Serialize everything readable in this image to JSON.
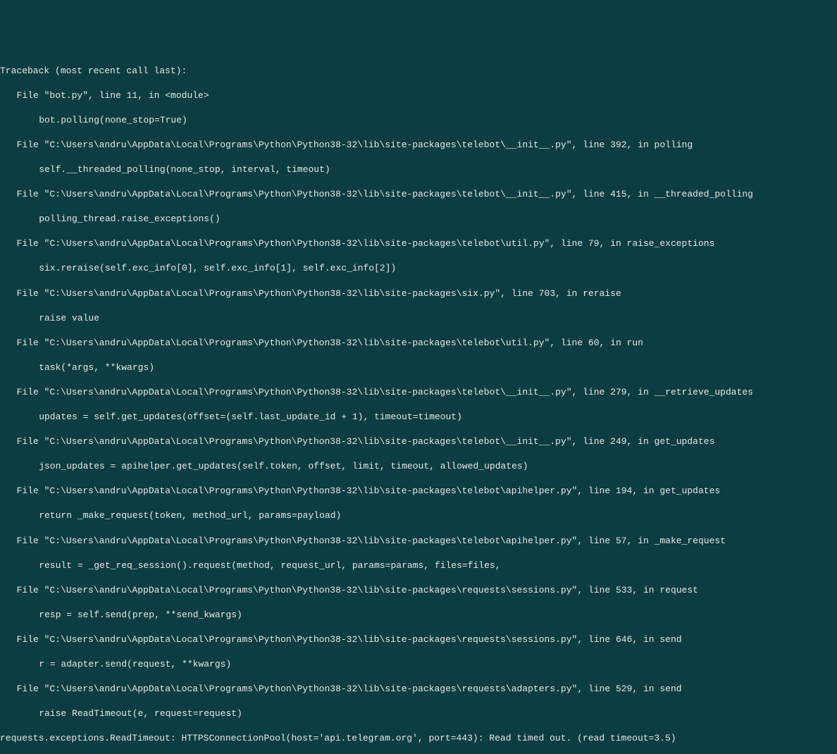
{
  "traceback": {
    "header": "Traceback (most recent call last):",
    "frames": [
      {
        "file": "  File \"bot.py\", line 11, in <module>",
        "code": "    bot.polling(none_stop=True)"
      },
      {
        "file": "  File \"C:\\Users\\andru\\AppData\\Local\\Programs\\Python\\Python38-32\\lib\\site-packages\\telebot\\__init__.py\", line 392, in polling",
        "code": "    self.__threaded_polling(none_stop, interval, timeout)"
      },
      {
        "file": "  File \"C:\\Users\\andru\\AppData\\Local\\Programs\\Python\\Python38-32\\lib\\site-packages\\telebot\\__init__.py\", line 415, in __threaded_polling",
        "code": "    polling_thread.raise_exceptions()"
      },
      {
        "file": "  File \"C:\\Users\\andru\\AppData\\Local\\Programs\\Python\\Python38-32\\lib\\site-packages\\telebot\\util.py\", line 79, in raise_exceptions",
        "code": "    six.reraise(self.exc_info[0], self.exc_info[1], self.exc_info[2])"
      },
      {
        "file": "  File \"C:\\Users\\andru\\AppData\\Local\\Programs\\Python\\Python38-32\\lib\\site-packages\\six.py\", line 703, in reraise",
        "code": "    raise value"
      },
      {
        "file": "  File \"C:\\Users\\andru\\AppData\\Local\\Programs\\Python\\Python38-32\\lib\\site-packages\\telebot\\util.py\", line 60, in run",
        "code": "    task(*args, **kwargs)"
      },
      {
        "file": "  File \"C:\\Users\\andru\\AppData\\Local\\Programs\\Python\\Python38-32\\lib\\site-packages\\telebot\\__init__.py\", line 279, in __retrieve_updates",
        "code": "    updates = self.get_updates(offset=(self.last_update_id + 1), timeout=timeout)"
      },
      {
        "file": "  File \"C:\\Users\\andru\\AppData\\Local\\Programs\\Python\\Python38-32\\lib\\site-packages\\telebot\\__init__.py\", line 249, in get_updates",
        "code": "    json_updates = apihelper.get_updates(self.token, offset, limit, timeout, allowed_updates)"
      },
      {
        "file": "  File \"C:\\Users\\andru\\AppData\\Local\\Programs\\Python\\Python38-32\\lib\\site-packages\\telebot\\apihelper.py\", line 194, in get_updates",
        "code": "    return _make_request(token, method_url, params=payload)"
      },
      {
        "file": "  File \"C:\\Users\\andru\\AppData\\Local\\Programs\\Python\\Python38-32\\lib\\site-packages\\telebot\\apihelper.py\", line 57, in _make_request",
        "code": "    result = _get_req_session().request(method, request_url, params=params, files=files,"
      },
      {
        "file": "  File \"C:\\Users\\andru\\AppData\\Local\\Programs\\Python\\Python38-32\\lib\\site-packages\\requests\\sessions.py\", line 533, in request",
        "code": "    resp = self.send(prep, **send_kwargs)"
      },
      {
        "file": "  File \"C:\\Users\\andru\\AppData\\Local\\Programs\\Python\\Python38-32\\lib\\site-packages\\requests\\sessions.py\", line 646, in send",
        "code": "    r = adapter.send(request, **kwargs)"
      },
      {
        "file": "  File \"C:\\Users\\andru\\AppData\\Local\\Programs\\Python\\Python38-32\\lib\\site-packages\\requests\\adapters.py\", line 529, in send",
        "code": "    raise ReadTimeout(e, request=request)"
      }
    ],
    "exception": "requests.exceptions.ReadTimeout: HTTPSConnectionPool(host='api.telegram.org', port=443): Read timed out. (read timeout=3.5)"
  }
}
